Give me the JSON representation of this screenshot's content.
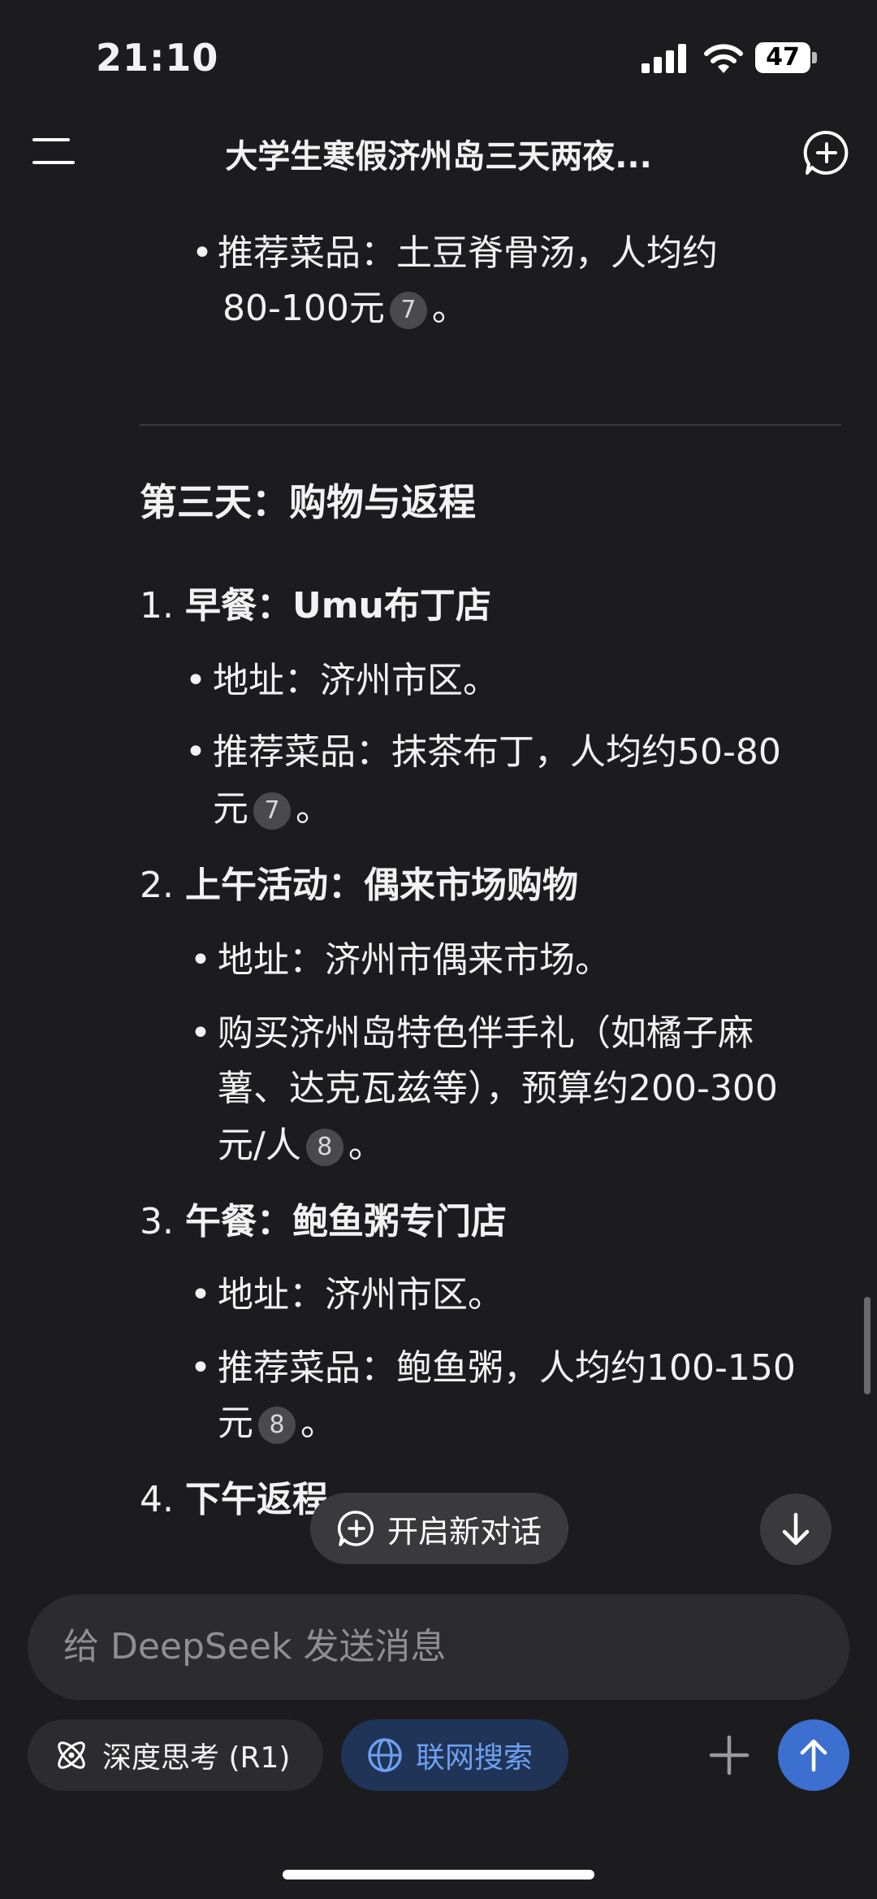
{
  "status_bar": {
    "time": "21:10",
    "battery": "47"
  },
  "nav": {
    "title": "大学生寒假济州岛三天两夜..."
  },
  "content": {
    "top_bullet": {
      "line1": "推荐菜品：土豆脊骨汤，人均约",
      "line2": "80-100元",
      "cite": "7",
      "end": "。"
    },
    "day3_heading": "第三天：购物与返程",
    "item1": {
      "num": "1.",
      "title": "早餐：Umu布丁店",
      "b1": "地址：济州市区。",
      "b2_line1": "推荐菜品：抹茶布丁，人均约50-80",
      "b2_line2": "元",
      "cite": "7",
      "end": "。"
    },
    "item2": {
      "num": "2.",
      "title": "上午活动：偶来市场购物",
      "b1": "地址：济州市偶来市场。",
      "b2_line1": "购买济州岛特色伴手礼（如橘子麻",
      "b2_line2": "薯、达克瓦兹等），预算约200-300",
      "b2_line3": "元/人",
      "cite": "8",
      "end": "。"
    },
    "item3": {
      "num": "3.",
      "title": "午餐：鲍鱼粥专门店",
      "b1": "地址：济州市区。",
      "b2_line1": "推荐菜品：鲍鱼粥，人均约100-150",
      "b2_line2": "元",
      "cite": "8",
      "end": "。"
    },
    "item4": {
      "num": "4.",
      "title": "下午返程"
    }
  },
  "floating": {
    "new_chat_label": "开启新对话"
  },
  "composer": {
    "placeholder": "给 DeepSeek 发送消息",
    "deep_think_label": "深度思考 (R1)",
    "web_search_label": "联网搜索"
  }
}
